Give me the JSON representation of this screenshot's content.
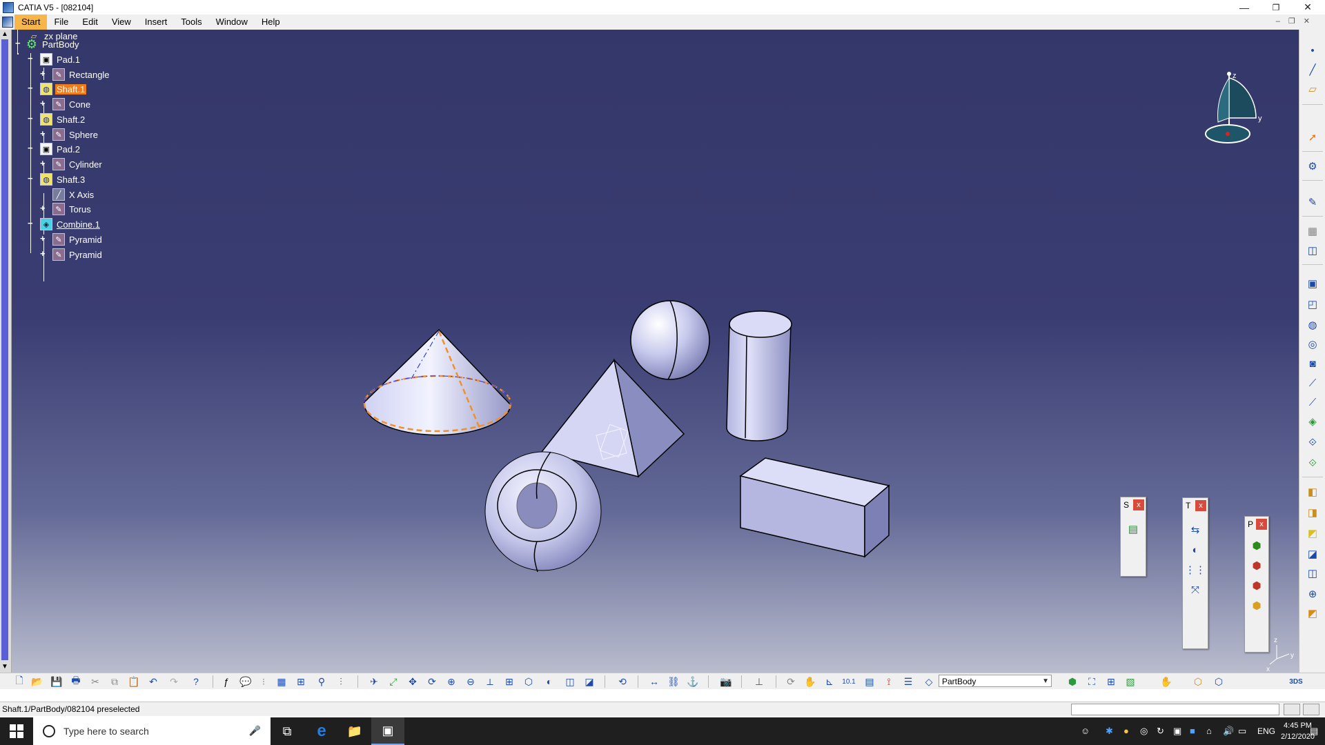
{
  "window": {
    "title": "CATIA V5 - [082104]",
    "minimize_glyph": "—",
    "restore_glyph": "❐",
    "close_glyph": "✕"
  },
  "menu": {
    "items": [
      "Start",
      "File",
      "Edit",
      "View",
      "Insert",
      "Tools",
      "Window",
      "Help"
    ],
    "active": "Start"
  },
  "tree": {
    "root_partial": "zx plane",
    "body": "PartBody",
    "nodes": [
      {
        "label": "Pad.1",
        "type": "pad"
      },
      {
        "label": "Rectangle",
        "type": "sketch"
      },
      {
        "label": "Shaft.1",
        "type": "shaft",
        "selected": true
      },
      {
        "label": "Cone",
        "type": "sketch"
      },
      {
        "label": "Shaft.2",
        "type": "shaft"
      },
      {
        "label": "Sphere",
        "type": "sketch"
      },
      {
        "label": "Pad.2",
        "type": "pad"
      },
      {
        "label": "Cylinder",
        "type": "sketch"
      },
      {
        "label": "Shaft.3",
        "type": "shaft"
      },
      {
        "label": "X Axis",
        "type": "axis"
      },
      {
        "label": "Torus",
        "type": "sketch"
      },
      {
        "label": "Combine.1",
        "type": "combine",
        "current": true
      },
      {
        "label": "Pyramid",
        "type": "sketch"
      },
      {
        "label": "Pyramid",
        "type": "sketch"
      }
    ]
  },
  "compass": {
    "z": "z",
    "y": "y"
  },
  "axis_indicator": {
    "z": "z",
    "y": "y",
    "x": "x"
  },
  "palettes": [
    {
      "title": "S",
      "close": "x"
    },
    {
      "title": "T",
      "close": "x"
    },
    {
      "title": "P",
      "close": "x"
    }
  ],
  "bottom_toolbar": {
    "current_body": "PartBody"
  },
  "status": {
    "text": "Shaft.1/PartBody/082104 preselected"
  },
  "taskbar": {
    "search_placeholder": "Type here to search",
    "language": "ENG",
    "time": "4:45 PM",
    "date": "2/12/2020"
  },
  "colors": {
    "viewport_top": "#343769",
    "viewport_bottom": "#b9bccd",
    "selection": "#f07b1b",
    "menu_active": "#f7b64b",
    "solid": "#c9cbeb"
  }
}
